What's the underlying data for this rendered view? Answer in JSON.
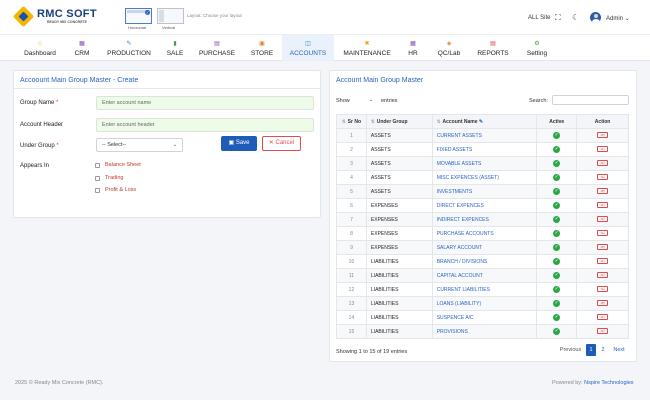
{
  "brand": {
    "title": "RMC SOFT",
    "subtitle": "READY MIX CONCRETE"
  },
  "layout": {
    "horizontal_label": "Horizontal",
    "vertical_label": "Vertical",
    "caption": "Layout: Choose your layout"
  },
  "header": {
    "site": "ALL Site",
    "user": "Admin"
  },
  "nav": [
    {
      "label": "Dashboard",
      "icon": "⌂",
      "color": "#f4a000"
    },
    {
      "label": "CRM",
      "icon": "▦",
      "color": "#8e44ad"
    },
    {
      "label": "PRODUCTION",
      "icon": "✎",
      "color": "#1e88e5"
    },
    {
      "label": "SALE",
      "icon": "▮",
      "color": "#43a047"
    },
    {
      "label": "PURCHASE",
      "icon": "▤",
      "color": "#8e44ad"
    },
    {
      "label": "STORE",
      "icon": "▣",
      "color": "#e67e22"
    },
    {
      "label": "ACCOUNTS",
      "icon": "◫",
      "color": "#1e88e5"
    },
    {
      "label": "MAINTENANCE",
      "icon": "✖",
      "color": "#f4a000"
    },
    {
      "label": "HR",
      "icon": "▦",
      "color": "#8e44ad"
    },
    {
      "label": "QC/Lab",
      "icon": "◈",
      "color": "#e67e22"
    },
    {
      "label": "REPORTS",
      "icon": "▤",
      "color": "#e53935"
    },
    {
      "label": "Setting",
      "icon": "⚙",
      "color": "#43a047"
    }
  ],
  "form": {
    "title": "Accoount Main Group Master - Create",
    "group_name_label": "Group Name",
    "group_name_placeholder": "Enter account name",
    "account_header_label": "Account Header",
    "account_header_placeholder": "Enter account header",
    "under_group_label": "Under Group",
    "under_group_value": "-- Select--",
    "appears_in_label": "Appears In",
    "options": [
      "Balance Sheet",
      "Trading",
      "Profit & Loss"
    ],
    "save_label": "Save",
    "cancel_label": "Cancel",
    "required_mark": "*"
  },
  "list": {
    "title": "Account Main Group Master",
    "show_label": "Show",
    "entries_label": "entries",
    "search_label": "Search:",
    "columns": [
      "Sr No",
      "Under Group",
      "Account Name",
      "Active",
      "Action"
    ],
    "rows": [
      {
        "sr": "1",
        "group": "ASSETS",
        "account": "CURRENT ASSETS"
      },
      {
        "sr": "2",
        "group": "ASSETS",
        "account": "FIXED ASSETS"
      },
      {
        "sr": "3",
        "group": "ASSETS",
        "account": "MOVABLE ASSETS"
      },
      {
        "sr": "4",
        "group": "ASSETS",
        "account": "MISC EXPENCES (ASSET)"
      },
      {
        "sr": "5",
        "group": "ASSETS",
        "account": "INVESTMENTS"
      },
      {
        "sr": "6",
        "group": "EXPENSES",
        "account": "DIRECT EXPENCES"
      },
      {
        "sr": "7",
        "group": "EXPENSES",
        "account": "INDIRECT EXPENCES"
      },
      {
        "sr": "8",
        "group": "EXPENSES",
        "account": "PURCHASE ACCOUNTS"
      },
      {
        "sr": "9",
        "group": "EXPENSES",
        "account": "SALARY ACCOUNT"
      },
      {
        "sr": "10",
        "group": "LIABILITIES",
        "account": "BRANCH / DIVISIONS"
      },
      {
        "sr": "11",
        "group": "LIABILITIES",
        "account": "CAPITAL ACCOUNT"
      },
      {
        "sr": "12",
        "group": "LIABILITIES",
        "account": "CURRENT LIABILITIES"
      },
      {
        "sr": "13",
        "group": "LIABILITIES",
        "account": "LOANS (LIABILITY)"
      },
      {
        "sr": "14",
        "group": "LIABILITIES",
        "account": "SUSPENCE A/C"
      },
      {
        "sr": "15",
        "group": "LIABILITIES",
        "account": "PROVISIONS"
      }
    ],
    "action_glyph": "•••",
    "active_glyph": "✓",
    "showing_text": "Showing 1 to 15 of 19 entries",
    "pager": {
      "prev": "Previous",
      "pages": [
        "1",
        "2"
      ],
      "next": "Next"
    }
  },
  "footer": {
    "copyright": "2025 © Ready Mix Concrete (RMC).",
    "powered_by": "Powered by:",
    "company": "Nspire Technologies"
  }
}
